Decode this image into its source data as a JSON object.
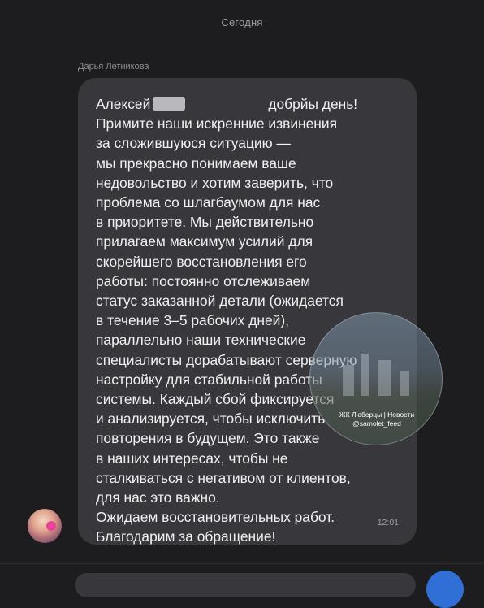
{
  "chat": {
    "date_separator": "Сегодня"
  },
  "message": {
    "sender": "Дарья Летникова",
    "greeting_name": "Алексей",
    "greeting_tail": "добрйы день!",
    "body": "Примите наши искренние извинения\nза сложившуюся ситуацию —\nмы прекрасно понимаем ваше\nнедовольство и хотим заверить, что\nпроблема со шлагбаумом для нас\nв приоритете. Мы действительно\nприлагаем максимум усилий для\nскорейшего восстановления его\nработы: постоянно отслеживаем\nстатус заказанной детали (ожидается\nв течение 3–5 рабочих дней),\nпараллельно наши технические\nспециалисты дорабатывают серверную\nнастройку для стабильной работы\nсистемы. Каждый сбой фиксируется\nи анализируется, чтобы исключить\nповторения в будущем. Это также\nв наших интересах, чтобы не\nсталкиваться с негативом от клиентов,\nдля нас это важно.\nОжидаем восстановительных работ.\nБлагодарим за обращение!",
    "time": "12:01"
  },
  "watermark": {
    "line1": "ЖК Люберцы | Новости",
    "line2": "@samolet_feed"
  },
  "colors": {
    "background": "#1d1d1f",
    "bubble": "#38383c",
    "text": "#f1f1f3",
    "send_button": "#2f6fd6"
  }
}
